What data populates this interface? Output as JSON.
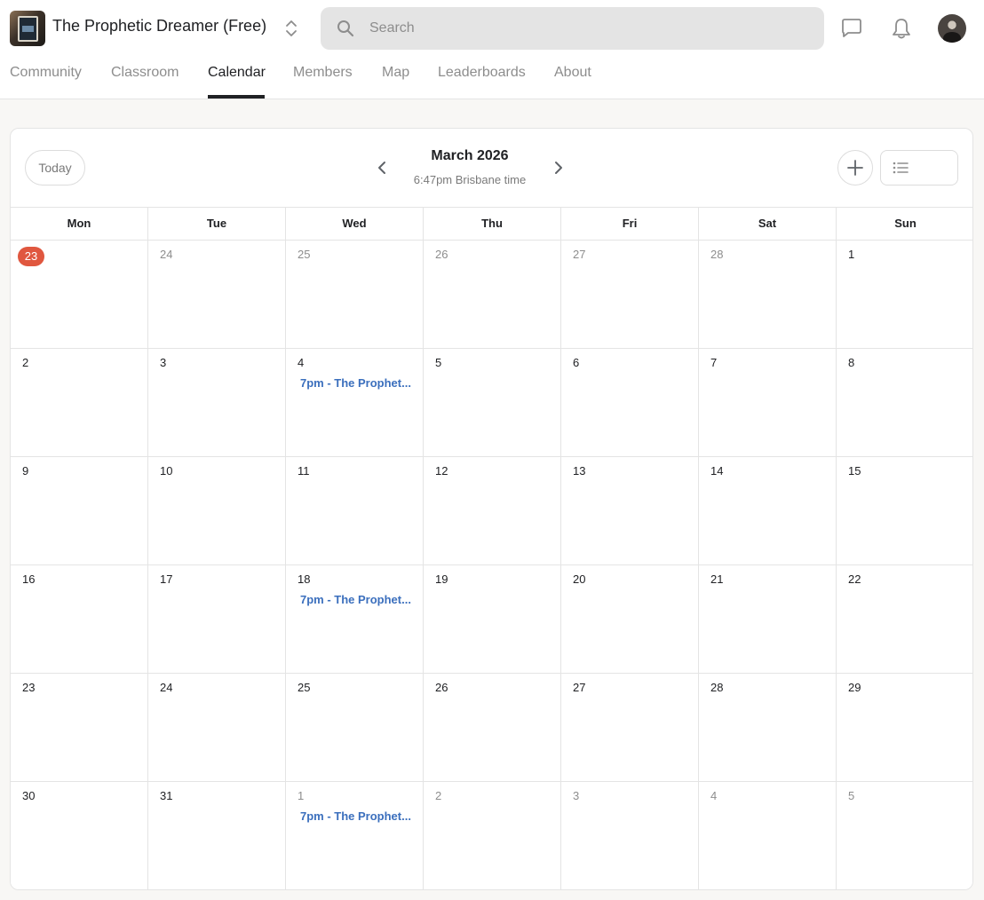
{
  "group": {
    "name": "The Prophetic Dreamer (Free)"
  },
  "search": {
    "placeholder": "Search"
  },
  "tabs": [
    {
      "label": "Community"
    },
    {
      "label": "Classroom"
    },
    {
      "label": "Calendar",
      "active": true
    },
    {
      "label": "Members"
    },
    {
      "label": "Map"
    },
    {
      "label": "Leaderboards"
    },
    {
      "label": "About"
    }
  ],
  "calendar": {
    "today_label": "Today",
    "month_title": "March 2026",
    "timezone_label": "6:47pm Brisbane time",
    "weekdays": [
      "Mon",
      "Tue",
      "Wed",
      "Thu",
      "Fri",
      "Sat",
      "Sun"
    ],
    "weeks": [
      [
        {
          "day": "23",
          "muted": false,
          "today": true
        },
        {
          "day": "24",
          "muted": true
        },
        {
          "day": "25",
          "muted": true
        },
        {
          "day": "26",
          "muted": true
        },
        {
          "day": "27",
          "muted": true
        },
        {
          "day": "28",
          "muted": true
        },
        {
          "day": "1",
          "muted": false
        }
      ],
      [
        {
          "day": "2"
        },
        {
          "day": "3"
        },
        {
          "day": "4",
          "event": "7pm - The Prophet..."
        },
        {
          "day": "5"
        },
        {
          "day": "6"
        },
        {
          "day": "7"
        },
        {
          "day": "8"
        }
      ],
      [
        {
          "day": "9"
        },
        {
          "day": "10"
        },
        {
          "day": "11"
        },
        {
          "day": "12"
        },
        {
          "day": "13"
        },
        {
          "day": "14"
        },
        {
          "day": "15"
        }
      ],
      [
        {
          "day": "16"
        },
        {
          "day": "17"
        },
        {
          "day": "18",
          "event": "7pm - The Prophet..."
        },
        {
          "day": "19"
        },
        {
          "day": "20"
        },
        {
          "day": "21"
        },
        {
          "day": "22"
        }
      ],
      [
        {
          "day": "23"
        },
        {
          "day": "24"
        },
        {
          "day": "25"
        },
        {
          "day": "26"
        },
        {
          "day": "27"
        },
        {
          "day": "28"
        },
        {
          "day": "29"
        }
      ],
      [
        {
          "day": "30"
        },
        {
          "day": "31"
        },
        {
          "day": "1",
          "muted": true,
          "event": "7pm - The Prophet..."
        },
        {
          "day": "2",
          "muted": true
        },
        {
          "day": "3",
          "muted": true
        },
        {
          "day": "4",
          "muted": true
        },
        {
          "day": "5",
          "muted": true
        }
      ]
    ]
  },
  "colors": {
    "today_badge": "#e0573f",
    "event_link": "#3b6fbd",
    "active_tab": "#202124"
  },
  "icons": {
    "logo": "group-logo",
    "switcher": "chevron-up-down-icon",
    "search": "search-icon",
    "chat": "chat-icon",
    "notifications": "bell-icon",
    "prev": "chevron-left-icon",
    "next": "chevron-right-icon",
    "add": "plus-icon",
    "list_view": "list-icon",
    "calendar_view": "calendar-icon"
  }
}
